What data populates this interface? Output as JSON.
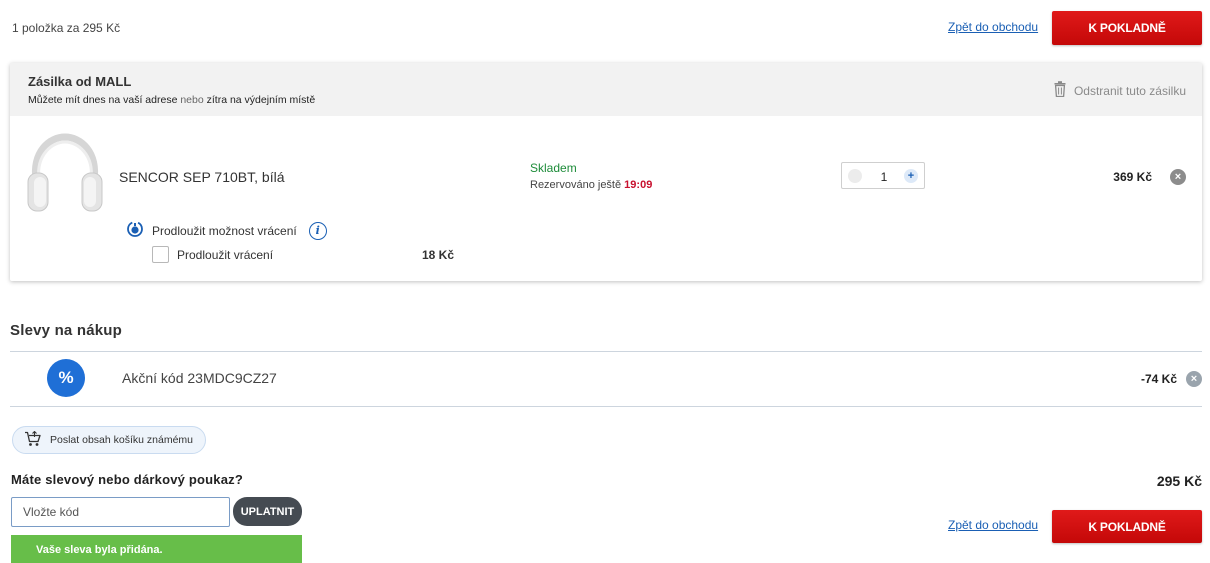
{
  "cart_summary": "1 položka za 295 Kč",
  "back_to_shop": "Zpět do obchodu",
  "checkout": "K POKLADNĚ",
  "shipment": {
    "title": "Zásilka od MALL",
    "subtitle_a": "Můžete mít dnes na vaší adrese",
    "subtitle_or": "nebo",
    "subtitle_b": "zítra na výdejním místě",
    "remove": "Odstranit tuto zásilku"
  },
  "product": {
    "name": "SENCOR SEP 710BT, bílá",
    "stock": "Skladem",
    "reserved_label": "Rezervováno ještě",
    "reserved_time": "19:09",
    "quantity": "1",
    "price": "369 Kč",
    "extend_title": "Prodloužit možnost vrácení",
    "extend_checkbox": "Prodloužit vrácení",
    "extend_price": "18 Kč"
  },
  "discounts": {
    "title": "Slevy na nákup",
    "icon_glyph": "%",
    "code_label": "Akční kód 23MDC9CZ27",
    "amount": "-74 Kč"
  },
  "share_cart": "Poslat obsah košíku známému",
  "voucher": {
    "question": "Máte slevový nebo dárkový poukaz?",
    "placeholder": "Vložte kód",
    "apply": "UPLATNIT",
    "success": "Vaše sleva byla přidána."
  },
  "total": "295 Kč",
  "colors": {
    "accent_red": "#d10f0f",
    "link_blue": "#1a5fb4",
    "stock_green": "#1e8c3a",
    "success_green": "#67be49"
  },
  "icons": [
    "trash-icon",
    "headphones-image",
    "minus-icon",
    "plus-icon",
    "remove-icon",
    "return-extension-icon",
    "info-icon",
    "percent-icon",
    "cart-share-icon"
  ]
}
